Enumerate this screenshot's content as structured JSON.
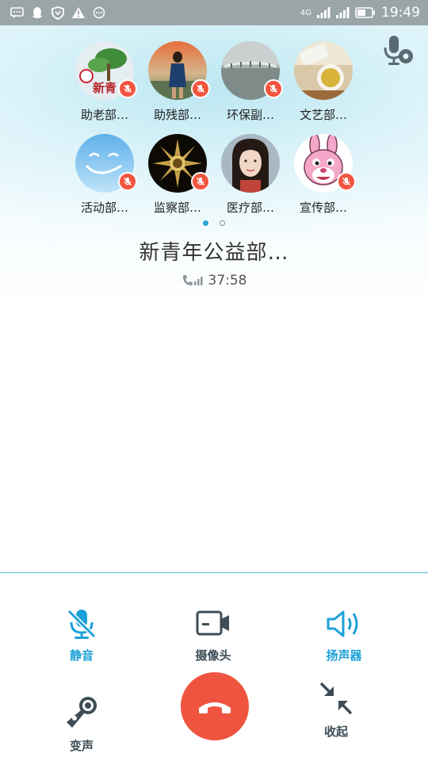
{
  "status_bar": {
    "network_label": "4G",
    "time": "19:49",
    "left_icons": [
      "message-icon",
      "qq-icon",
      "shield-icon",
      "warning-icon",
      "more-icon"
    ]
  },
  "members": [
    {
      "name": "助老部…",
      "muted": true
    },
    {
      "name": "助残部…",
      "muted": true
    },
    {
      "name": "环保副…",
      "muted": true
    },
    {
      "name": "文艺部…",
      "muted": false
    },
    {
      "name": "活动部…",
      "muted": true
    },
    {
      "name": "监察部…",
      "muted": true
    },
    {
      "name": "医疗部…",
      "muted": false
    },
    {
      "name": "宣传部…",
      "muted": true
    }
  ],
  "avatar_texts": {
    "a0": "新青"
  },
  "pager": {
    "pages": 2,
    "active": 1
  },
  "call": {
    "group_name": "新青年公益部…",
    "duration": "37:58"
  },
  "controls": {
    "mute": "静音",
    "camera": "摄像头",
    "speaker": "扬声器",
    "voice_change": "变声",
    "collapse": "收起"
  },
  "colors": {
    "accent": "#1da0d8",
    "hangup": "#ef5440",
    "muted_badge": "#f2553f",
    "status_bar": "#9aa5a8"
  }
}
